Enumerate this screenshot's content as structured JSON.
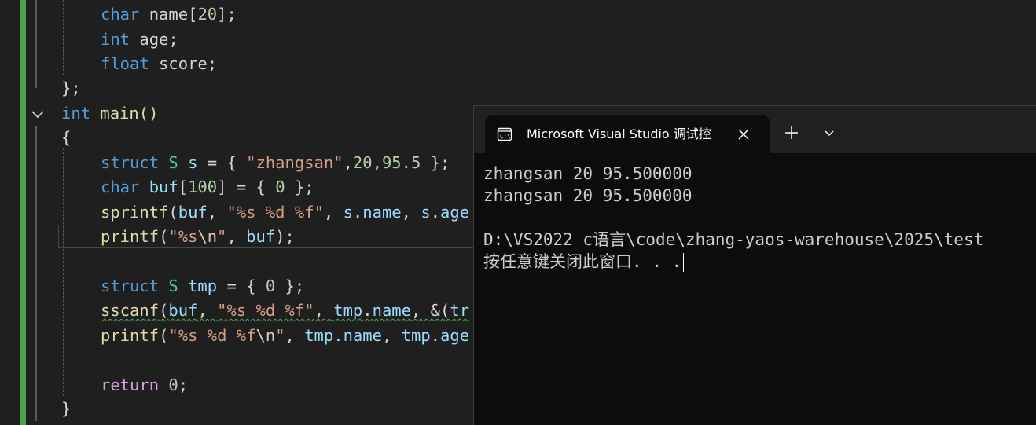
{
  "editor": {
    "lines": [
      [
        "char",
        " name",
        "[",
        "20",
        "];"
      ],
      [
        "int",
        " age;"
      ],
      [
        "float",
        " score;"
      ],
      [
        "};"
      ],
      [
        "int",
        " main()"
      ],
      [
        "{"
      ],
      [
        "struct",
        " S",
        " s",
        " = { ",
        "\"zhangsan\"",
        ",",
        "20",
        ",",
        "95.5",
        " };"
      ],
      [
        "char",
        " buf",
        "[",
        "100",
        "] = { ",
        "0",
        " };"
      ],
      [
        "sprintf",
        "(",
        "buf",
        ", ",
        "\"",
        "%s %d %f",
        "\"",
        ", ",
        "s",
        ".",
        "name",
        ", ",
        "s",
        ".",
        "age"
      ],
      [
        "printf",
        "(",
        "\"",
        "%s",
        "\\n",
        "\"",
        ", ",
        "buf",
        ");"
      ],
      [
        "struct",
        " S",
        " tmp",
        " = { ",
        "0",
        " };"
      ],
      [
        "sscanf",
        "(",
        "buf",
        ", ",
        "\"",
        "%s %d %f",
        "\"",
        ", ",
        "tmp",
        ".",
        "name",
        ", &(",
        "tr"
      ],
      [
        "printf",
        "(",
        "\"",
        "%s %d %f",
        "\\n",
        "\"",
        ", ",
        "tmp",
        ".",
        "name",
        ", ",
        "tmp",
        ".",
        "age"
      ],
      [
        "return",
        " ",
        "0",
        ";"
      ],
      [
        "}"
      ]
    ],
    "colors": {
      "gutter_change": "#4aa34a",
      "keyword": "#569cd6",
      "type": "#4ec9b0",
      "variable": "#9cdcfe",
      "function": "#dcdcaa",
      "string": "#d69d85",
      "number": "#b5cea8",
      "warning_squiggle": "#4fae4f"
    }
  },
  "terminal": {
    "tab_title": "Microsoft Visual Studio 调试控",
    "tab_icon": "console-icon",
    "close_icon": "close-icon",
    "new_tab_icon": "plus-icon",
    "dropdown_icon": "chevron-down-icon",
    "output": [
      "zhangsan 20 95.500000",
      "zhangsan 20 95.500000",
      "",
      "D:\\VS2022 c语言\\code\\zhang-yaos-warehouse\\2025\\test",
      "按任意键关闭此窗口. . ."
    ]
  }
}
